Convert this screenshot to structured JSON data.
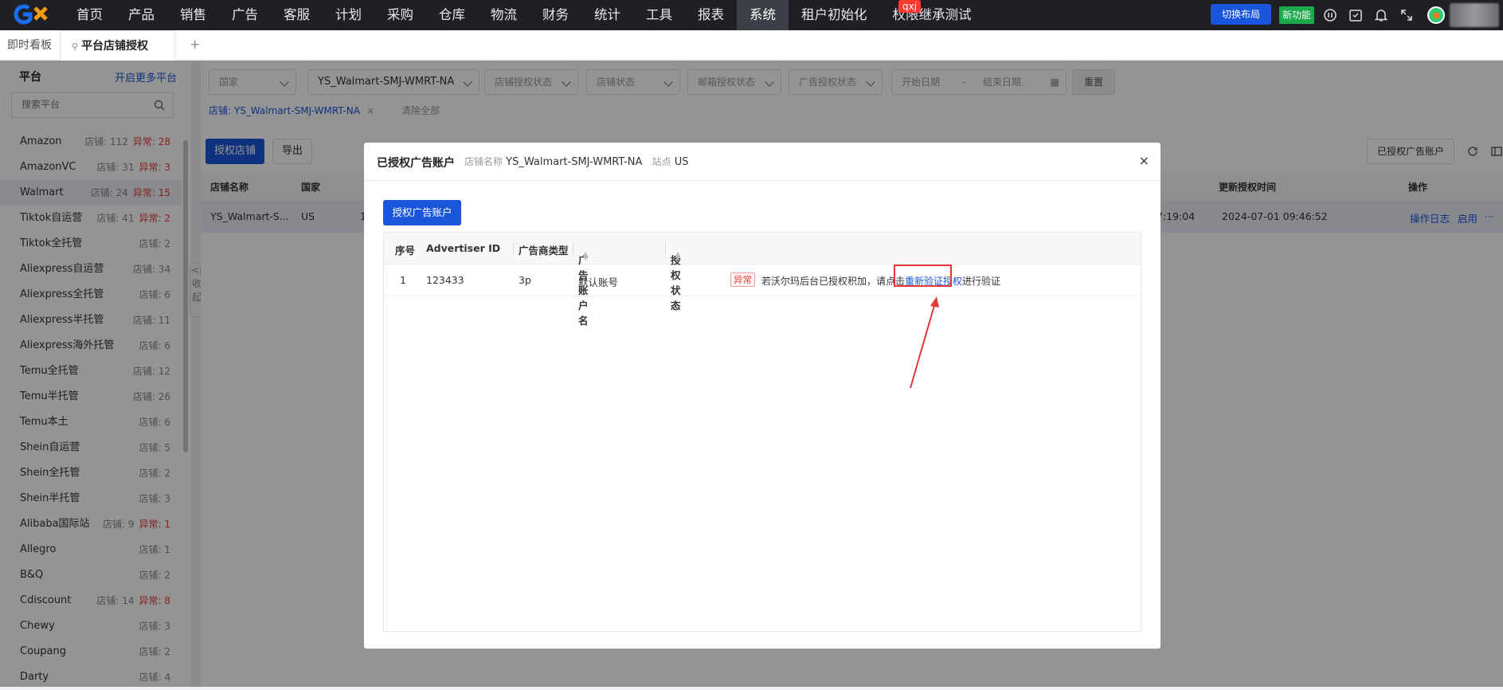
{
  "topnav": {
    "items": [
      "首页",
      "产品",
      "销售",
      "广告",
      "客服",
      "计划",
      "采购",
      "仓库",
      "物流",
      "财务",
      "统计",
      "工具",
      "报表",
      "系统",
      "租户初始化",
      "权限继承测试"
    ],
    "active_index": 13,
    "badge": "qxj",
    "switch_layout": "切换布局",
    "new_feature": "新功能"
  },
  "tabs": {
    "dashboard": "即时看板",
    "current": "平台店铺授权",
    "add": "+"
  },
  "sidebar": {
    "title": "平台",
    "open_more": "开启更多平台",
    "search_placeholder": "搜索平台",
    "platforms": [
      {
        "name": "Amazon",
        "count": "店铺: 112",
        "error": "异常: 28"
      },
      {
        "name": "AmazonVC",
        "count": "店铺: 31",
        "error": "异常: 3"
      },
      {
        "name": "Walmart",
        "count": "店铺: 24",
        "error": "异常: 15",
        "active": true
      },
      {
        "name": "Tiktok自运营",
        "count": "店铺: 41",
        "error": "异常: 2"
      },
      {
        "name": "Tiktok全托管",
        "count": "店铺: 2"
      },
      {
        "name": "Aliexpress自运营",
        "count": "店铺: 34"
      },
      {
        "name": "Aliexpress全托管",
        "count": "店铺: 6"
      },
      {
        "name": "Aliexpress半托管",
        "count": "店铺: 11"
      },
      {
        "name": "Aliexpress海外托管",
        "count": "店铺: 6"
      },
      {
        "name": "Temu全托管",
        "count": "店铺: 12"
      },
      {
        "name": "Temu半托管",
        "count": "店铺: 26"
      },
      {
        "name": "Temu本土",
        "count": "店铺: 6"
      },
      {
        "name": "Shein自运营",
        "count": "店铺: 5"
      },
      {
        "name": "Shein全托管",
        "count": "店铺: 2"
      },
      {
        "name": "Shein半托管",
        "count": "店铺: 3"
      },
      {
        "name": "Alibaba国际站",
        "count": "店铺: 9",
        "error": "异常: 1"
      },
      {
        "name": "Allegro",
        "count": "店铺: 1"
      },
      {
        "name": "B&Q",
        "count": "店铺: 2"
      },
      {
        "name": "Cdiscount",
        "count": "店铺: 14",
        "error": "异常: 8"
      },
      {
        "name": "Chewy",
        "count": "店铺: 3"
      },
      {
        "name": "Coupang",
        "count": "店铺: 2"
      },
      {
        "name": "Darty",
        "count": "店铺: 4"
      }
    ],
    "collapse": [
      "<|",
      "收",
      "起"
    ]
  },
  "filters": {
    "country": "国家",
    "shop": "YS_Walmart-SMJ-WMRT-NA",
    "shop_auth_status": "店铺授权状态",
    "shop_status": "店铺状态",
    "mail_auth_status": "邮箱授权状态",
    "ad_auth_status": "广告授权状态",
    "start_date": "开始日期",
    "date_sep": "-",
    "end_date": "结束日期",
    "reset": "重置"
  },
  "active_filter_tag": {
    "label": "店铺: YS_Walmart-SMJ-WMRT-NA",
    "remove": "×",
    "clear_all": "清除全部"
  },
  "toolbar": {
    "auth_shop": "授权店铺",
    "export": "导出",
    "authorized_ad_accounts": "已授权广告账户"
  },
  "table": {
    "headers": {
      "shop_name": "店铺名称",
      "country": "国家",
      "updated_time": "更新授权时间",
      "actions": "操作"
    },
    "row": {
      "shop_name": "YS_Walmart-S...",
      "country": "US",
      "col3": "1",
      "time_partial": "7:19:04",
      "updated_time": "2024-07-01 09:46:52",
      "log": "操作日志",
      "enable": "启用",
      "more": "···"
    }
  },
  "modal": {
    "title": "已授权广告账户",
    "shop_label": "店铺名称",
    "shop_value": "YS_Walmart-SMJ-WMRT-NA",
    "site_label": "站点",
    "site_value": "US",
    "close": "×",
    "auth_button": "授权广告账户",
    "headers": {
      "index": "序号",
      "advertiser_id": "Advertiser ID",
      "advertiser_type": "广告商类型",
      "account_name": "广告账户名",
      "auth_status": "授权状态"
    },
    "rows": [
      {
        "index": "1",
        "advertiser_id": "123433",
        "advertiser_type": "3p",
        "account_name": "默认账号",
        "status_tag": "异常",
        "status_text_pre": "若沃尔玛后台已授权积加，请点击",
        "status_link": "重新验证授权",
        "status_text_post": "进行验证"
      }
    ]
  },
  "colors": {
    "accent": "#1a56db",
    "topbar": "#1f2026",
    "error": "#e53935",
    "new_feature": "#1aa94b",
    "annotation": "#e53935"
  },
  "icons": [
    "logo",
    "pause-icon",
    "calendar-check-icon",
    "bell-icon",
    "fullscreen-icon",
    "avatar",
    "search-icon",
    "pin-icon",
    "chevron-down-icon",
    "refresh-icon",
    "columns-icon",
    "close-icon",
    "sort-icon",
    "annotation-arrow"
  ]
}
